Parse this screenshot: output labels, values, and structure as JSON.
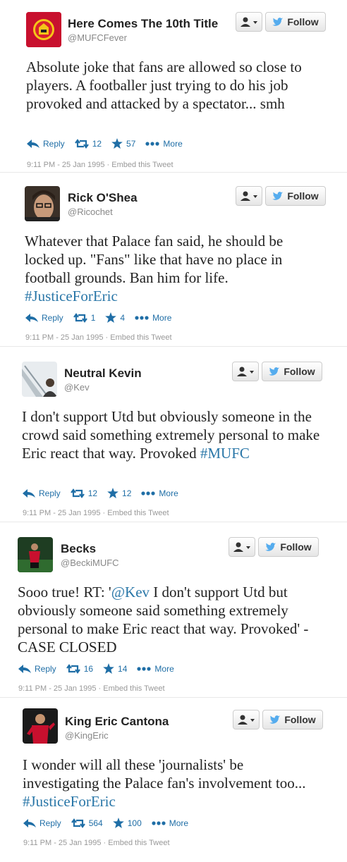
{
  "follow_label": "Follow",
  "actions_labels": {
    "reply": "Reply",
    "more": "More"
  },
  "embed_label": "Embed this Tweet",
  "tweets": [
    {
      "name": "Here Comes The 10th Title",
      "handle": "@MUFCFever",
      "text": [
        "Absolute joke that fans are allowed so close to players. A footballer just trying to do his job provoked and attacked by a spectator... smh"
      ],
      "retweets": "12",
      "favorites": "57",
      "timestamp": "9:11 PM - 25 Jan 1995",
      "avatar": "manutd-crest-avatar"
    },
    {
      "name": "Rick O'Shea",
      "handle": "@Ricochet",
      "text": [
        "Whatever that Palace fan said, he should be locked up. \"Fans\" like that have no place in football grounds. Ban him for life.",
        "#JusticeForEric"
      ],
      "retweets": "1",
      "favorites": "4",
      "timestamp": "9:11 PM - 25 Jan 1995",
      "avatar": "man-glasses-avatar"
    },
    {
      "name": "Neutral Kevin",
      "handle": "@Kev",
      "text": [
        "I don't support Utd but obviously someone in the crowd said something extremely personal to make Eric react that way. Provoked",
        "#MUFC"
      ],
      "retweets": "12",
      "favorites": "12",
      "timestamp": "9:11 PM - 25 Jan 1995",
      "avatar": "stadium-avatar"
    },
    {
      "name": "Becks",
      "handle": "@BeckiMUFC",
      "text": [
        "Sooo true! RT: '",
        "@Kev",
        " I don't support Utd but obviously someone said something extremely personal to make Eric react that way. Provoked' - CASE CLOSED"
      ],
      "retweets": "16",
      "favorites": "14",
      "timestamp": "9:11 PM - 25 Jan 1995",
      "avatar": "player-pitch-avatar"
    },
    {
      "name": "King Eric Cantona",
      "handle": "@KingEric",
      "text": [
        "I wonder will all these 'journalists' be investigating the Palace fan's involvement too...",
        "#JusticeForEric"
      ],
      "retweets": "564",
      "favorites": "100",
      "timestamp": "9:11 PM - 25 Jan 1995",
      "avatar": "cantona-avatar"
    }
  ],
  "colors": {
    "link": "#1f6ea6",
    "hashtag": "#2a77a8",
    "bird": "#55acee",
    "manutd_red": "#c8102e"
  }
}
